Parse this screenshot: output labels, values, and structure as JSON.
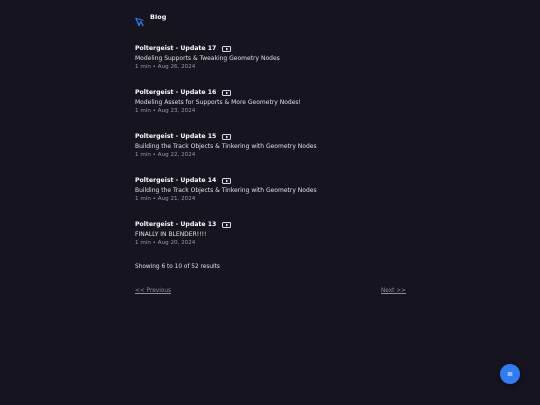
{
  "header": {
    "brand": "Blog",
    "logo_icon": "logo-icon"
  },
  "posts": [
    {
      "title": "Poltergeist - Update 17",
      "description": "Modeling Supports & Tweaking Geometry Nodes",
      "meta": "1 min • Aug 26, 2024",
      "badge_icon": "play-icon"
    },
    {
      "title": "Poltergeist - Update 16",
      "description": "Modeling Assets for Supports & More Geometry Nodes!",
      "meta": "1 min • Aug 23, 2024",
      "badge_icon": "play-icon"
    },
    {
      "title": "Poltergeist - Update 15",
      "description": "Building the Track Objects & Tinkering with Geometry Nodes",
      "meta": "1 min • Aug 22, 2024",
      "badge_icon": "play-icon"
    },
    {
      "title": "Poltergeist - Update 14",
      "description": "Building the Track Objects & Tinkering with Geometry Nodes",
      "meta": "1 min • Aug 21, 2024",
      "badge_icon": "play-icon"
    },
    {
      "title": "Poltergeist - Update 13",
      "description": "FINALLY IN BLENDER!!!!",
      "meta": "1 min • Aug 20, 2024",
      "badge_icon": "play-icon"
    }
  ],
  "results_text": "Showing 6 to 10 of 52 results",
  "pagination": {
    "previous_label": "<< Previous",
    "next_label": "Next >>"
  },
  "fab": {
    "icon": "menu-icon",
    "color": "#2f7cf6"
  },
  "colors": {
    "background": "#15141f",
    "accent": "#2f7cf6",
    "text": "#ffffff",
    "muted": "#9b9aa9"
  }
}
